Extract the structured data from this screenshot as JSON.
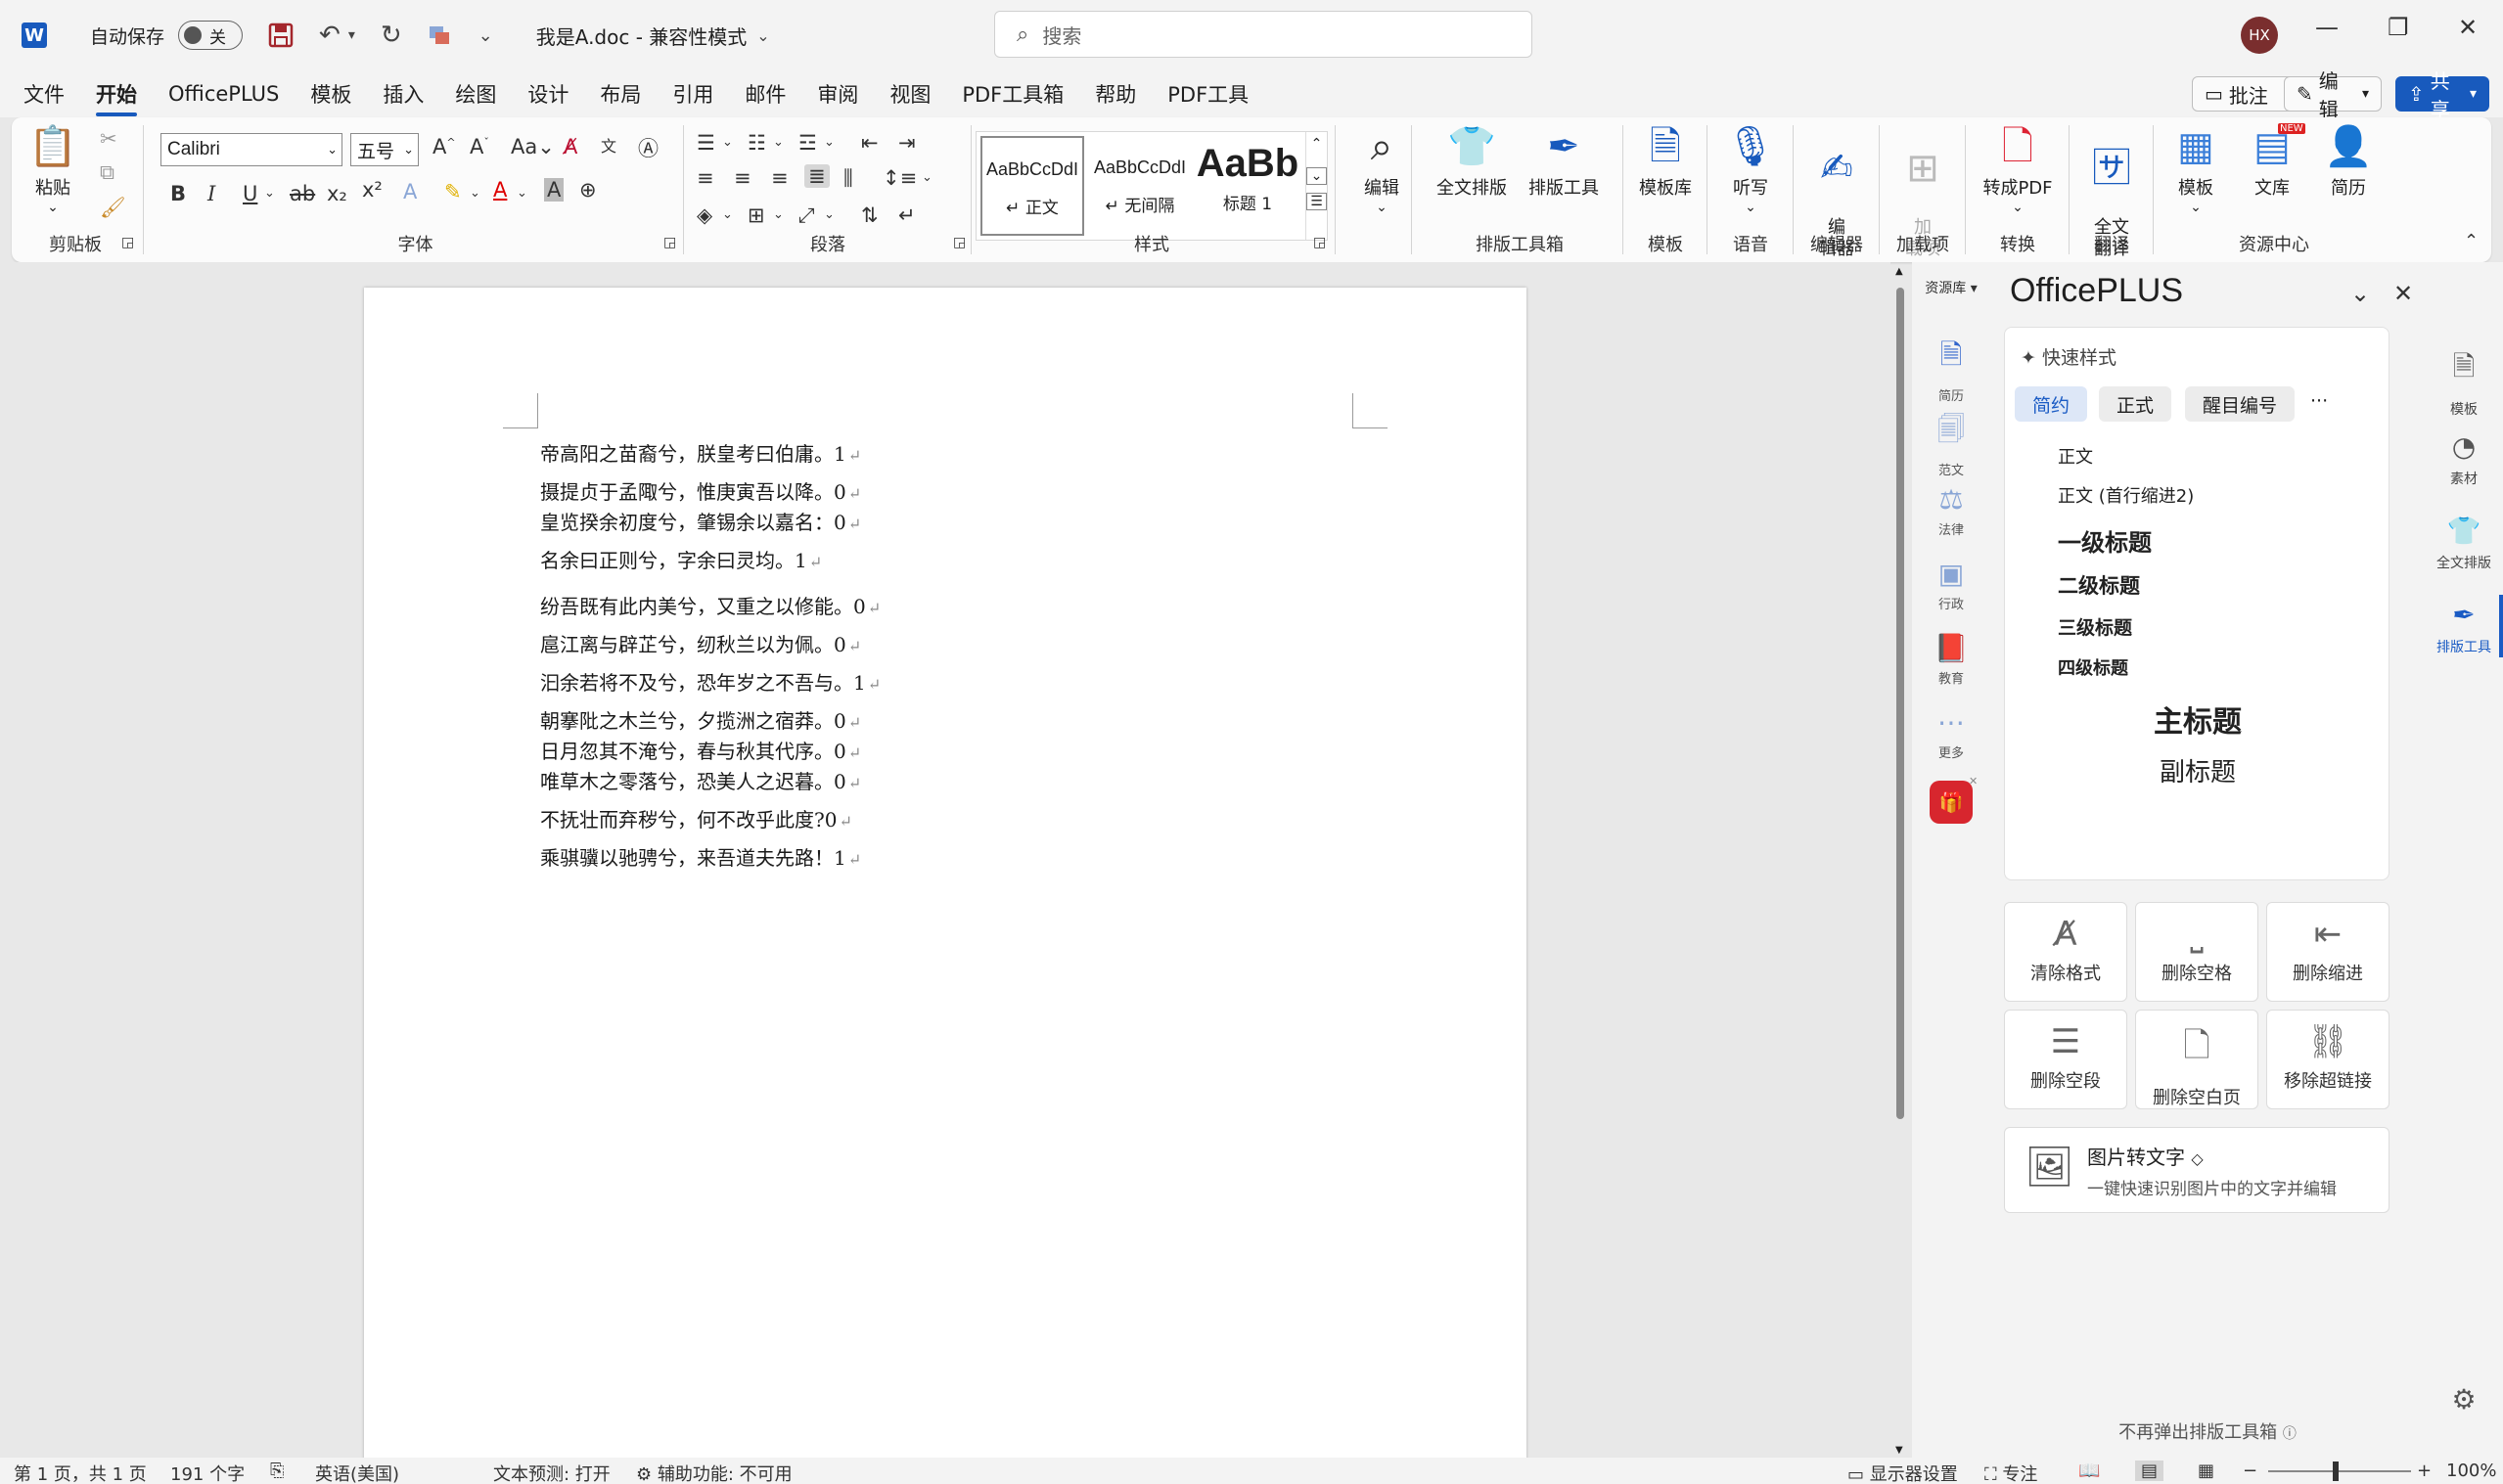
{
  "titlebar": {
    "app_logo": "W",
    "autosave_label": "自动保存",
    "autosave_state": "关",
    "doc_title": "我是A.doc  -  兼容性模式",
    "search_placeholder": "搜索",
    "user_initials": "HX",
    "icons": [
      "word-logo-icon",
      "save-icon",
      "undo-icon",
      "redo-icon",
      "customize-qat-icon"
    ]
  },
  "menu": {
    "tabs": [
      "文件",
      "开始",
      "OfficePLUS",
      "模板",
      "插入",
      "绘图",
      "设计",
      "布局",
      "引用",
      "邮件",
      "审阅",
      "视图",
      "PDF工具箱",
      "帮助",
      "PDF工具"
    ],
    "active_tab": "开始",
    "comment_btn": "批注",
    "edit_btn": "编辑",
    "share_btn": "共享"
  },
  "ribbon": {
    "clipboard": {
      "label": "剪贴板",
      "paste": "粘贴"
    },
    "font": {
      "label": "字体",
      "font_name": "Calibri",
      "font_size": "五号"
    },
    "paragraph": {
      "label": "段落"
    },
    "styles": {
      "label": "样式",
      "items": [
        {
          "sample": "AaBbCcDdI",
          "name": "↵ 正文"
        },
        {
          "sample": "AaBbCcDdI",
          "name": "↵ 无间隔"
        },
        {
          "sample": "AaBb",
          "name": "标题 1"
        }
      ]
    },
    "edit_btn": "编辑",
    "layout_toolbox": {
      "label": "排版工具箱",
      "full_layout": "全文排版",
      "layout_tool": "排版工具"
    },
    "template": {
      "label": "模板",
      "btn": "模板库"
    },
    "voice": {
      "label": "语音",
      "btn": "听写"
    },
    "editor": {
      "label": "编辑器",
      "btn": "编\n辑器"
    },
    "addins": {
      "label": "加载项",
      "btn": "加\n载项"
    },
    "convert": {
      "label": "转换",
      "btn": "转成PDF"
    },
    "translate": {
      "label": "翻译",
      "btn": "全文\n翻译"
    },
    "resource": {
      "label": "资源中心",
      "templates": "模板",
      "library": "文库",
      "resume": "简历",
      "new_badge": "NEW"
    }
  },
  "document": {
    "lines": [
      {
        "text": "帝高阳之苗裔兮，朕皇考曰伯庸。1"
      },
      {
        "text": "摄提贞于孟陬兮，惟庚寅吾以降。0"
      },
      {
        "text": "皇览揆余初度兮，肇锡余以嘉名：0"
      },
      {
        "text": "名余曰正则兮，字余曰灵均。1"
      },
      {
        "text": "纷吾既有此内美兮，又重之以修能。0"
      },
      {
        "text": "扈江离与辟芷兮，纫秋兰以为佩。0"
      },
      {
        "text": "汩余若将不及兮，恐年岁之不吾与。1"
      },
      {
        "text": "朝搴阰之木兰兮，夕揽洲之宿莽。0"
      },
      {
        "text": "日月忽其不淹兮，春与秋其代序。0"
      },
      {
        "text": "唯草木之零落兮，恐美人之迟暮。0"
      },
      {
        "text": "不抚壮而弃秽兮，何不改乎此度?0"
      },
      {
        "text": "乘骐骥以驰骋兮，来吾道夫先路！1"
      }
    ],
    "para_mark": "↵"
  },
  "rail": {
    "top_label": "资源库",
    "items": [
      "简历",
      "范文",
      "法律",
      "行政",
      "教育",
      "更多"
    ]
  },
  "pane": {
    "title": "OfficePLUS",
    "quick_style_header": "快速样式",
    "chips": [
      "简约",
      "正式",
      "醒目编号"
    ],
    "chip_more": "···",
    "style_list": [
      {
        "text": "正文",
        "size": 18,
        "bold": false
      },
      {
        "text": "正文 (首行缩进2)",
        "size": 18,
        "bold": false
      },
      {
        "text": "一级标题",
        "size": 24,
        "bold": true
      },
      {
        "text": "二级标题",
        "size": 21,
        "bold": true
      },
      {
        "text": "三级标题",
        "size": 19,
        "bold": true
      },
      {
        "text": "四级标题",
        "size": 18,
        "bold": true
      },
      {
        "text": "主标题",
        "size": 30,
        "bold": true
      },
      {
        "text": "副标题",
        "size": 26,
        "bold": false
      }
    ],
    "tools": [
      "清除格式",
      "删除空格",
      "删除缩进",
      "删除空段",
      "删除空白页",
      "移除超链接"
    ],
    "ocr": {
      "title": "图片转文字",
      "desc": "一键快速识别图片中的文字并编辑"
    },
    "footer": "不再弹出排版工具箱"
  },
  "right_rail": {
    "items": [
      "模板",
      "素材",
      "全文排版",
      "排版工具"
    ],
    "active": "排版工具"
  },
  "status": {
    "page": "第 1 页，共 1 页",
    "words": "191 个字",
    "language": "英语(美国)",
    "predict": "文本预测: 打开",
    "accessibility": "辅助功能: 不可用",
    "display": "显示器设置",
    "focus": "专注",
    "zoom": "100%"
  }
}
